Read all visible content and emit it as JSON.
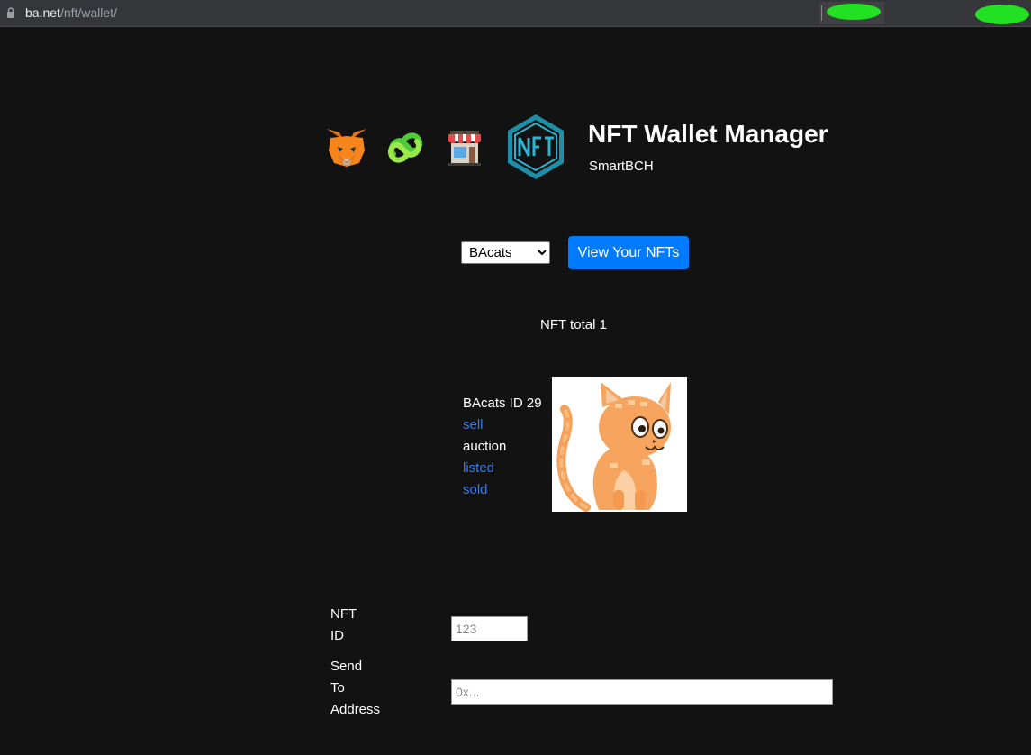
{
  "browser": {
    "url_host": "ba.net",
    "url_path": "/nft/wallet/"
  },
  "header": {
    "title": "NFT Wallet Manager",
    "subtitle": "SmartBCH",
    "logos": [
      "metamask-fox-icon",
      "smartbch-chain-icon",
      "storefront-icon",
      "nft-hexagon-logo"
    ]
  },
  "controls": {
    "collection_options": [
      "BAcats"
    ],
    "collection_selected": "BAcats",
    "view_button_label": "View Your NFTs",
    "accent_color": "#007bff"
  },
  "summary": {
    "total_text": "NFT total 1"
  },
  "nft": {
    "title": "BAcats ID 29",
    "actions": {
      "sell": "sell",
      "auction": "auction",
      "listed": "listed",
      "sold": "sold"
    },
    "image": "orange-cat-illustration"
  },
  "transfer": {
    "nft_id_label_line1": "NFT",
    "nft_id_label_line2": "ID",
    "nft_id_placeholder": "123",
    "address_label_line1": "Send",
    "address_label_line2": "To",
    "address_label_line3": "Address",
    "address_placeholder": "0x..."
  }
}
